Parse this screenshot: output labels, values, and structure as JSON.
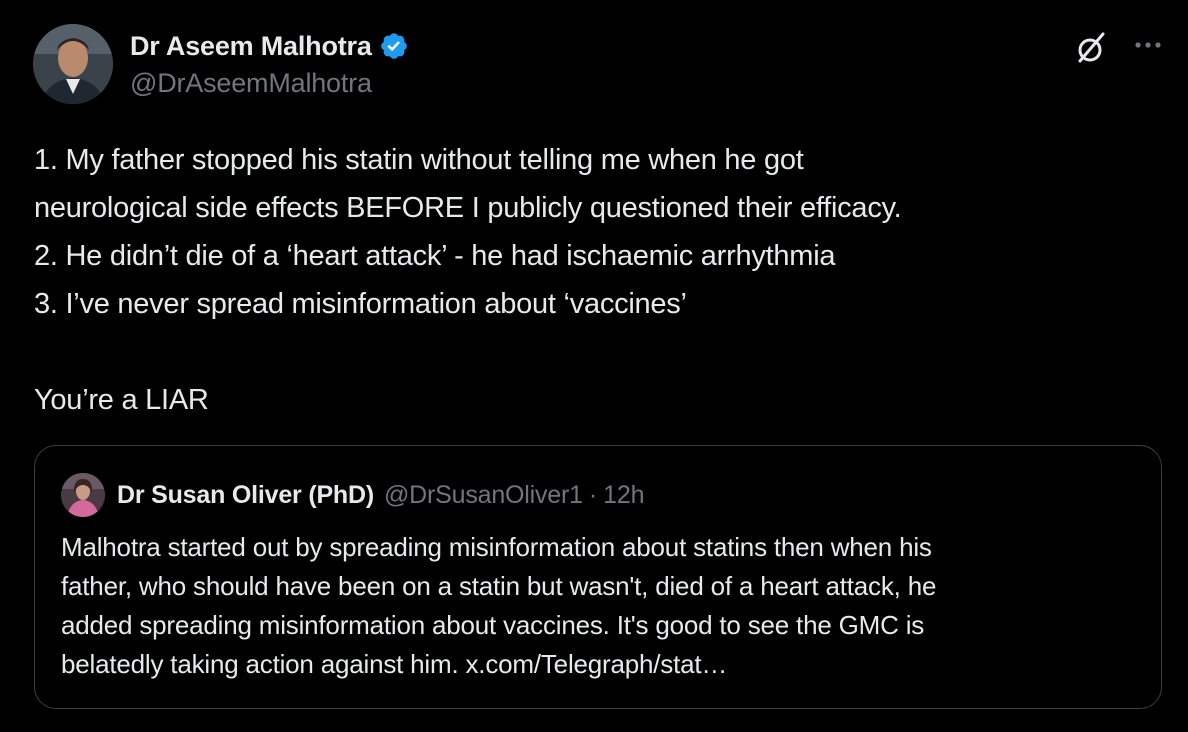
{
  "tweet": {
    "author": {
      "display_name": "Dr Aseem Malhotra",
      "handle": "@DrAseemMalhotra",
      "verified": true,
      "avatar_icon": "profile-photo"
    },
    "actions": {
      "grok_icon": "grok-icon",
      "more_icon": "more-horizontal-icon"
    },
    "body_lines": [
      "1. My father stopped his statin without telling me when he got",
      "neurological side effects BEFORE I publicly questioned their efficacy.",
      "2. He didn’t die of a ‘heart attack’ - he had ischaemic arrhythmia",
      "3. I’ve never spread misinformation about ‘vaccines’",
      "",
      "You’re a LIAR"
    ],
    "quoted": {
      "display_name": "Dr Susan Oliver (PhD)",
      "handle": "@DrSusanOliver1",
      "separator": "·",
      "time": "12h",
      "text_lines": [
        "Malhotra started out by spreading misinformation about statins then when his",
        "father, who should have been on a statin but wasn't, died of a heart attack, he",
        "added spreading misinformation about vaccines. It's good to see the GMC is",
        "belatedly taking action against him. x.com/Telegraph/stat…"
      ]
    }
  },
  "colors": {
    "background": "#000000",
    "primary_text": "#e7e9ea",
    "secondary_text": "#71767b",
    "border": "#3a3d41",
    "verified_badge": "#1d9bf0"
  }
}
